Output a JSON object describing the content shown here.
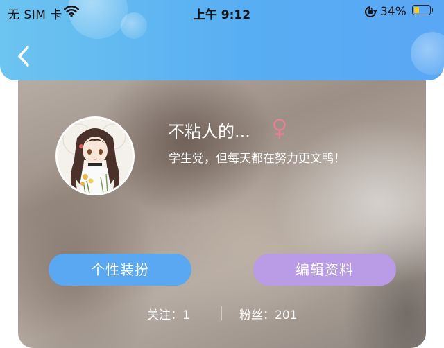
{
  "status_bar": {
    "carrier": "无 SIM 卡",
    "time": "上午 9:12",
    "battery_percent": "34%",
    "battery_level": 0.34,
    "icons": [
      "wifi-icon",
      "orientation-lock-icon",
      "battery-icon"
    ]
  },
  "header": {
    "back_icon": "chevron-left-icon",
    "colors": {
      "start": "#6cc4f0",
      "end": "#5aa7f5"
    }
  },
  "profile": {
    "nickname": "不粘人的...",
    "gender_icon": "female-symbol-icon",
    "gender_color": "#e97f97",
    "signature": "学生党，但每天都在努力更文鸭！",
    "avatar": "anime-girl-avatar"
  },
  "actions": {
    "personalize_label": "个性装扮",
    "personalize_color": "#5aa7f2",
    "edit_label": "编辑资料",
    "edit_color": "#b99be6"
  },
  "stats": {
    "following_label": "关注：",
    "following_count": "1",
    "followers_label": "粉丝：",
    "followers_count": "201"
  }
}
